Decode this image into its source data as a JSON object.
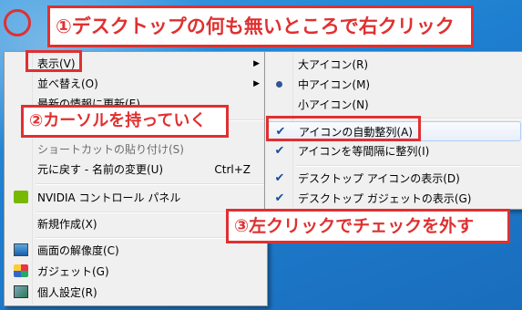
{
  "annotations": {
    "step1": "①デスクトップの何も無いところで右クリック",
    "step2": "②カーソルを持っていく",
    "step3": "③左クリックでチェックを外す"
  },
  "context_menu": {
    "view": "表示(V)",
    "sort_by": "並べ替え(O)",
    "refresh_partial": "最新の情報に更新(E)",
    "paste_shortcut": "ショートカットの貼り付け(S)",
    "undo_rename": "元に戻す - 名前の変更(U)",
    "undo_shortcut": "Ctrl+Z",
    "nvidia": "NVIDIA コントロール パネル",
    "new": "新規作成(X)",
    "screen_resolution": "画面の解像度(C)",
    "gadgets": "ガジェット(G)",
    "personalize": "個人設定(R)"
  },
  "view_submenu": {
    "large_icons": "大アイコン(R)",
    "medium_icons": "中アイコン(M)",
    "small_icons": "小アイコン(N)",
    "auto_arrange": "アイコンの自動整列(A)",
    "align_to_grid": "アイコンを等間隔に整列(I)",
    "show_desktop_icons": "デスクトップ アイコンの表示(D)",
    "show_gadgets": "デスクトップ ガジェットの表示(G)"
  }
}
